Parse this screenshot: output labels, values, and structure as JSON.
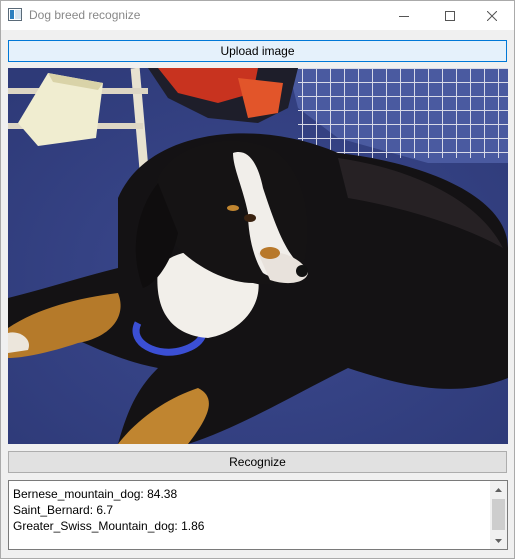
{
  "window": {
    "title": "Dog breed recognize"
  },
  "toolbar": {
    "upload_label": "Upload image",
    "recognize_label": "Recognize"
  },
  "photo": {
    "subject": "dog-photo"
  },
  "results": {
    "lines": [
      "Bernese_mountain_dog: 84.38",
      "Saint_Bernard: 6.7",
      "Greater_Swiss_Mountain_dog: 1.86"
    ]
  },
  "colors": {
    "upload_border": "#0078d7",
    "upload_bg": "#e5f1fb",
    "button_bg": "#e1e1e1",
    "window_bg": "#f0f0f0"
  }
}
